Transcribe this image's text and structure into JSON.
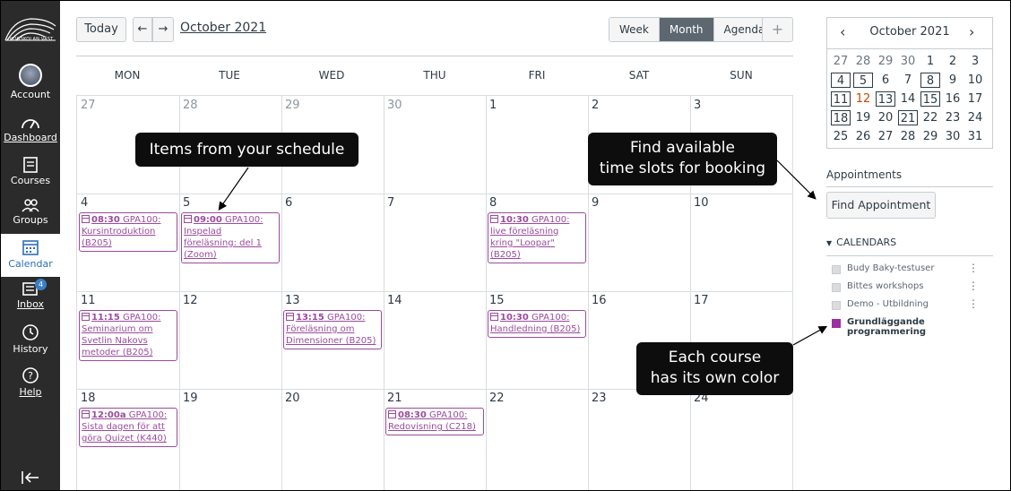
{
  "nav": {
    "logo_text": "HÖGSKOLAN VÄST",
    "items": [
      {
        "label": "Account"
      },
      {
        "label": "Dashboard"
      },
      {
        "label": "Courses"
      },
      {
        "label": "Groups"
      },
      {
        "label": "Calendar"
      },
      {
        "label": "Inbox",
        "badge": "4"
      },
      {
        "label": "History"
      },
      {
        "label": "Help"
      }
    ],
    "collapse_icon": "collapse-left-icon"
  },
  "toolbar": {
    "today": "Today",
    "prev": "←",
    "next": "→",
    "title": "October 2021",
    "views": [
      "Week",
      "Month",
      "Agenda"
    ],
    "active_view": "Month",
    "add": "+"
  },
  "calendar": {
    "days_of_week": [
      "MON",
      "TUE",
      "WED",
      "THU",
      "FRI",
      "SAT",
      "SUN"
    ],
    "weeks": [
      [
        "27",
        "28",
        "29",
        "30",
        "1",
        "2",
        "3"
      ],
      [
        "4",
        "5",
        "6",
        "7",
        "8",
        "9",
        "10"
      ],
      [
        "11",
        "12",
        "13",
        "14",
        "15",
        "16",
        "17"
      ],
      [
        "18",
        "19",
        "20",
        "21",
        "22",
        "23",
        "24"
      ]
    ],
    "events": {
      "w1_mon": {
        "time": "08:30",
        "text": "GPA100: Kursintroduktion (B205)"
      },
      "w1_tue": {
        "time": "09:00",
        "text": "GPA100: Inspelad föreläsning: del 1 (Zoom)"
      },
      "w1_fri": {
        "time": "10:30",
        "text": "GPA100: live föreläsning kring \"Loopar\" (B205)"
      },
      "w2_mon": {
        "time": "11:15",
        "text": "GPA100: Seminarium om Svetlin Nakovs metoder (B205)"
      },
      "w2_wed": {
        "time": "13:15",
        "text": "GPA100: Föreläsning om Dimensioner (B205)"
      },
      "w2_fri": {
        "time": "10:30",
        "text": "GPA100: Handledning (B205)"
      },
      "w3_mon": {
        "time": "12:00a",
        "text": "GPA100: Sista dagen för att göra Quizet (K440)"
      },
      "w3_thu": {
        "time": "08:30",
        "text": "GPA100: Redovisning (C218)"
      }
    },
    "event_color": "#9b4a9d"
  },
  "mini_calendar": {
    "title": "October 2021",
    "prev": "‹",
    "next": "›",
    "rows": [
      [
        "27",
        "28",
        "29",
        "30",
        "1",
        "2",
        "3"
      ],
      [
        "4",
        "5",
        "6",
        "7",
        "8",
        "9",
        "10"
      ],
      [
        "11",
        "12",
        "13",
        "14",
        "15",
        "16",
        "17"
      ],
      [
        "18",
        "19",
        "20",
        "21",
        "22",
        "23",
        "24"
      ],
      [
        "25",
        "26",
        "27",
        "28",
        "29",
        "30",
        "31"
      ]
    ]
  },
  "appointments": {
    "title": "Appointments",
    "button": "Find Appointment"
  },
  "calendars": {
    "title": "CALENDARS",
    "items": [
      {
        "label": "Budy Baky-testuser",
        "color": "#dcdcdc"
      },
      {
        "label": "Bittes workshops",
        "color": "#dcdcdc"
      },
      {
        "label": "Demo - Utbildning",
        "color": "#dcdcdc"
      },
      {
        "label": "Grundläggande programmering",
        "color": "#9b30a0"
      }
    ]
  },
  "callouts": {
    "schedule": "Items from your schedule",
    "booking_1": "Find available",
    "booking_2": "time slots for booking",
    "color_1": "Each course",
    "color_2": "has its own color"
  }
}
